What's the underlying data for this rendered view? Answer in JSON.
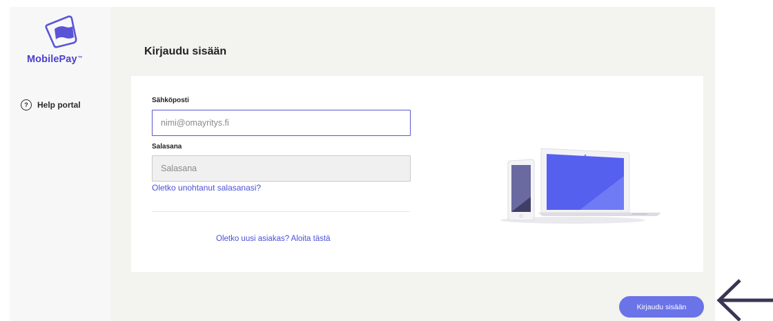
{
  "sidebar": {
    "brand": "MobilePay",
    "brand_mark": "™",
    "help_icon_glyph": "?",
    "help_label": "Help portal"
  },
  "page": {
    "title": "Kirjaudu sisään"
  },
  "form": {
    "email_label": "Sähköposti",
    "email_placeholder": "nimi@omayritys.fi",
    "password_label": "Salasana",
    "password_placeholder": "Salasana",
    "forgot_link": "Oletko unohtanut salasanasi?",
    "new_customer_link": "Oletko uusi asiakas? Aloita tästä"
  },
  "footer": {
    "login_button": "Kirjaudu sisään"
  },
  "icons": {
    "logo": "mobilepay-logo-icon",
    "help": "help-icon",
    "illustration": "devices-illustration",
    "arrow": "arrow-left-icon"
  },
  "colors": {
    "brand": "#4a3fd0",
    "accent": "#6b73e8",
    "link": "#4a50d8"
  }
}
